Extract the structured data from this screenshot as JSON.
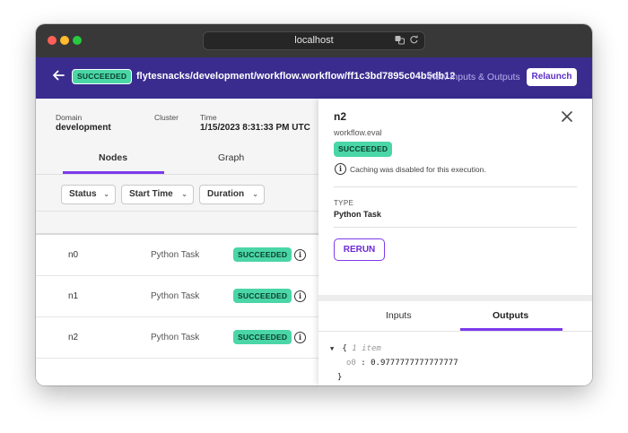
{
  "browser": {
    "url": "localhost"
  },
  "header": {
    "status": "SUCCEEDED",
    "execution_path": "flytesnacks/development/workflow.workflow/ff1c3bd7895c04b5db12",
    "view_io_label": "View Inputs & Outputs",
    "relaunch_label": "Relaunch"
  },
  "meta": {
    "domain_label": "Domain",
    "domain_value": "development",
    "cluster_label": "Cluster",
    "time_label": "Time",
    "time_value": "1/15/2023 8:31:33 PM UTC"
  },
  "tabs": [
    {
      "label": "Nodes",
      "active": true
    },
    {
      "label": "Graph",
      "active": false
    }
  ],
  "filters": [
    {
      "label": "Status"
    },
    {
      "label": "Start Time"
    },
    {
      "label": "Duration"
    }
  ],
  "nodes": [
    {
      "id": "n0",
      "type": "Python Task",
      "status": "SUCCEEDED"
    },
    {
      "id": "n1",
      "type": "Python Task",
      "status": "SUCCEEDED"
    },
    {
      "id": "n2",
      "type": "Python Task",
      "status": "SUCCEEDED"
    }
  ],
  "details": {
    "title": "n2",
    "subtitle": "workflow.eval",
    "status": "SUCCEEDED",
    "cache_note": "Caching was disabled for this execution.",
    "type_label": "TYPE",
    "type_value": "Python Task",
    "rerun_label": "RERUN",
    "io_tabs": [
      {
        "label": "Inputs",
        "active": false
      },
      {
        "label": "Outputs",
        "active": true
      }
    ],
    "outputs": {
      "open_brace": "{",
      "summary": "1 item",
      "key": "o0",
      "separator": ":",
      "value": "0.9777777777777777",
      "close_brace": "}"
    }
  },
  "colors": {
    "appbar": "#3a2c8f",
    "success": "#4ad6a6",
    "accent": "#7c3aed"
  },
  "icons": [
    "back-arrow-icon",
    "translate-icon",
    "reload-icon",
    "info-icon",
    "close-icon",
    "chevron-down-icon",
    "caret-down-icon"
  ]
}
